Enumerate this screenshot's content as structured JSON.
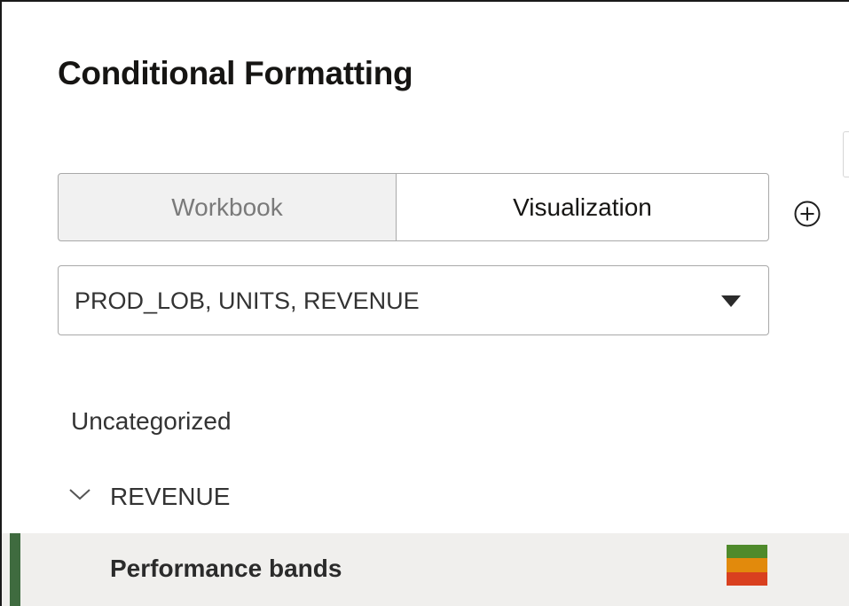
{
  "panel": {
    "title": "Conditional Formatting"
  },
  "scope_tabs": [
    {
      "label": "Workbook",
      "selected": false
    },
    {
      "label": "Visualization",
      "selected": true
    }
  ],
  "add_button": {
    "icon": "plus-circle-icon"
  },
  "column_select": {
    "value": "PROD_LOB, UNITS, REVENUE",
    "icon": "caret-down-icon"
  },
  "rules": {
    "category_label": "Uncategorized",
    "group": {
      "label": "REVENUE",
      "expanded": true,
      "icon": "chevron-down-icon"
    },
    "items": [
      {
        "label": "Performance bands",
        "selected": true,
        "swatch_colors": [
          "#4f8a2b",
          "#e28a0c",
          "#d9401f"
        ]
      }
    ]
  },
  "colors": {
    "selected_row_bg": "#f0efed",
    "selected_accent": "#3f6b3f",
    "border": "#a9a9a9"
  }
}
